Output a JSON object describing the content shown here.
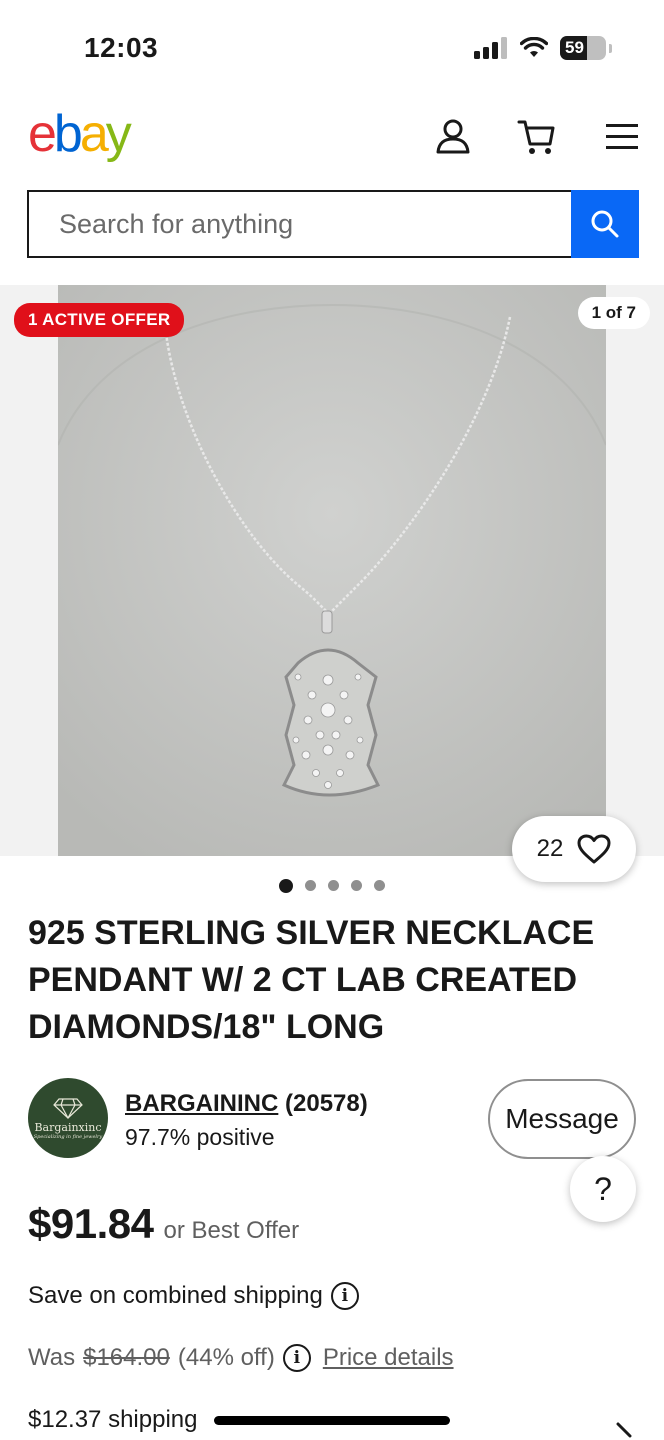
{
  "status": {
    "time": "12:03",
    "battery": "59",
    "battery_level": 0.59
  },
  "header": {
    "logo": [
      "e",
      "b",
      "a",
      "y"
    ],
    "icons": [
      "account-icon",
      "cart-icon",
      "menu-icon"
    ]
  },
  "search": {
    "placeholder": "Search for anything",
    "button_icon": "search-icon"
  },
  "hero": {
    "offer_badge": "1 ACTIVE OFFER",
    "counter": "1 of 7",
    "watch_count": "22",
    "dots": 5,
    "active_dot": 0
  },
  "listing": {
    "title": "925 STERLING SILVER NECKLACE PENDANT W/ 2 CT LAB CREATED DIAMONDS/18\" LONG"
  },
  "seller": {
    "avatar_name": "Bargainxinc",
    "avatar_tagline": "Specializing in fine jewelry",
    "name": "BARGAININC",
    "feedback": "(20578)",
    "positive": "97.7% positive",
    "message_label": "Message",
    "help_label": "?"
  },
  "pricing": {
    "price": "$91.84",
    "best_offer": "or Best Offer",
    "combined_shipping": "Save on combined shipping",
    "was_label": "Was",
    "was_price": "$164.00",
    "discount": "(44% off)",
    "price_details": "Price details",
    "shipping": "$12.37 shipping"
  },
  "colors": {
    "ebay_red": "#e53238",
    "ebay_blue": "#0064d2",
    "ebay_yellow": "#f5af02",
    "ebay_green": "#86b817",
    "search_blue": "#0968f6",
    "offer_red": "#e0101a"
  }
}
